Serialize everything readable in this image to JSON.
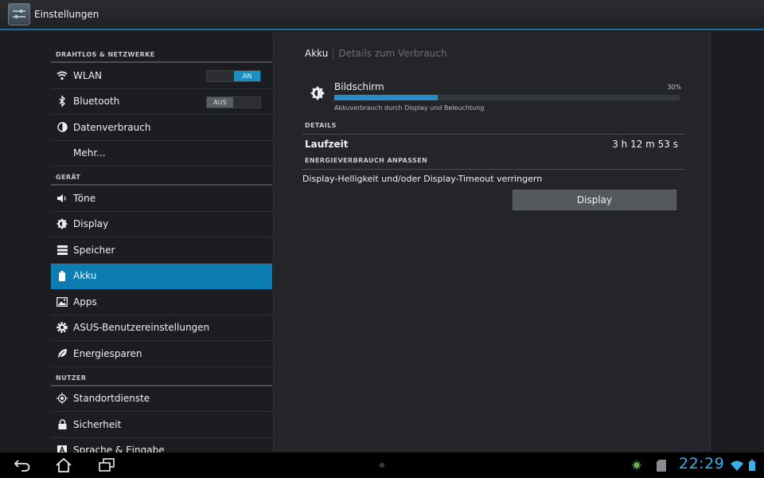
{
  "action_bar": {
    "title": "Einstellungen",
    "icon": "settings-sliders-icon"
  },
  "left": {
    "sections": [
      {
        "header": "DRAHTLOS & NETZWERKE",
        "items": [
          {
            "label": "WLAN",
            "icon": "wifi-icon",
            "toggle": "AN"
          },
          {
            "label": "Bluetooth",
            "icon": "bluetooth-icon",
            "toggle": "AUS"
          },
          {
            "label": "Datenverbrauch",
            "icon": "data-usage-icon"
          },
          {
            "label": "Mehr..."
          }
        ]
      },
      {
        "header": "GERÄT",
        "items": [
          {
            "label": "Töne",
            "icon": "volume-icon"
          },
          {
            "label": "Display",
            "icon": "brightness-icon"
          },
          {
            "label": "Speicher",
            "icon": "storage-icon"
          },
          {
            "label": "Akku",
            "icon": "battery-icon",
            "selected": true
          },
          {
            "label": "Apps",
            "icon": "apps-icon"
          },
          {
            "label": "ASUS-Benutzereinstellungen",
            "icon": "gear-icon"
          },
          {
            "label": "Energiesparen",
            "icon": "leaf-icon"
          }
        ]
      },
      {
        "header": "NUTZER",
        "items": [
          {
            "label": "Standortdienste",
            "icon": "location-icon"
          },
          {
            "label": "Sicherheit",
            "icon": "lock-icon"
          },
          {
            "label": "Sprache & Eingabe",
            "icon": "language-icon"
          }
        ]
      }
    ]
  },
  "right": {
    "breadcrumb": {
      "current": "Akku",
      "sub": "Details zum Verbrauch"
    },
    "usage": {
      "name": "Bildschirm",
      "percent_label": "30%",
      "percent_value": 30,
      "description": "Akkuverbrauch durch Display und Beleuchtung",
      "icon": "brightness-icon"
    },
    "details_header": "DETAILS",
    "runtime": {
      "label": "Laufzeit",
      "value": "3 h 12 m 53 s"
    },
    "adjust_header": "ENERGIEVERBRAUCH ANPASSEN",
    "hint": "Display-Helligkeit und/oder Display-Timeout verringern",
    "button_label": "Display"
  },
  "system_bar": {
    "clock": "22:29",
    "nav": [
      "back-icon",
      "home-icon",
      "recent-apps-icon"
    ],
    "status_icons": [
      "android-debug-icon",
      "sd-card-icon",
      "wifi-signal-icon",
      "battery-status-icon"
    ]
  },
  "colors": {
    "accent": "#0d7cb0",
    "clock": "#39b0e8",
    "bar_fill": "#2a8cc4"
  }
}
